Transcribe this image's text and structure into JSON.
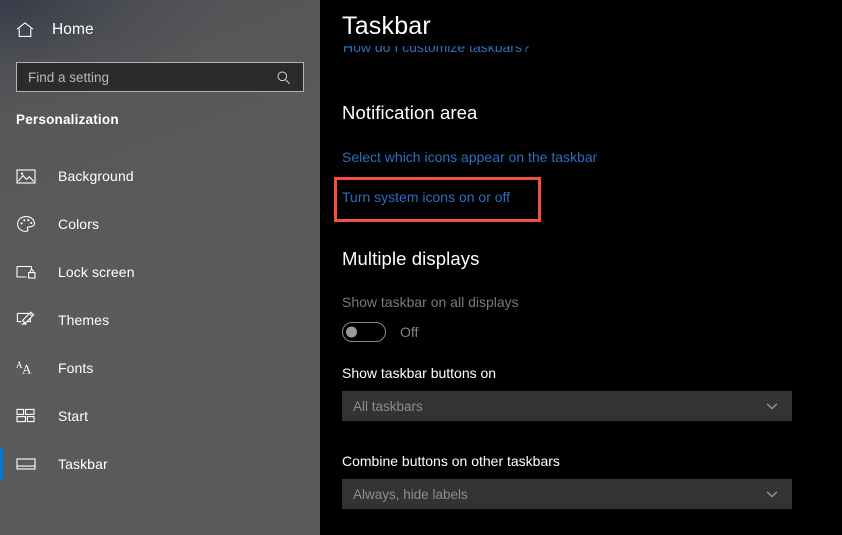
{
  "sidebar": {
    "home": {
      "label": "Home",
      "icon": "home-icon"
    },
    "search": {
      "placeholder": "Find a setting",
      "value": "",
      "icon": "search-icon"
    },
    "category_label": "Personalization",
    "items": [
      {
        "label": "Background",
        "icon": "picture-icon",
        "selected": false
      },
      {
        "label": "Colors",
        "icon": "palette-icon",
        "selected": false
      },
      {
        "label": "Lock screen",
        "icon": "lock-screen-icon",
        "selected": false
      },
      {
        "label": "Themes",
        "icon": "brush-icon",
        "selected": false
      },
      {
        "label": "Fonts",
        "icon": "fonts-aa-icon",
        "selected": false
      },
      {
        "label": "Start",
        "icon": "start-tiles-icon",
        "selected": false
      },
      {
        "label": "Taskbar",
        "icon": "taskbar-icon",
        "selected": true
      }
    ],
    "selection_color": "#0078d7"
  },
  "content": {
    "page_title": "Taskbar",
    "scrolled_link": "How do I customize taskbars?",
    "notification": {
      "heading": "Notification area",
      "link_select_icons": "Select which icons appear on the taskbar",
      "link_system_icons": "Turn system icons on or off"
    },
    "highlight": {
      "color": "#f4503c",
      "target": "Turn system icons on or off"
    },
    "multiple_displays": {
      "heading": "Multiple displays",
      "show_on_all": {
        "label": "Show taskbar on all displays",
        "state": "Off",
        "enabled": false
      },
      "buttons_on": {
        "label": "Show taskbar buttons on",
        "value": "All taskbars",
        "chevron": "chevron-down-icon"
      },
      "combine": {
        "label": "Combine buttons on other taskbars",
        "value": "Always, hide labels",
        "chevron": "chevron-down-icon"
      }
    }
  }
}
